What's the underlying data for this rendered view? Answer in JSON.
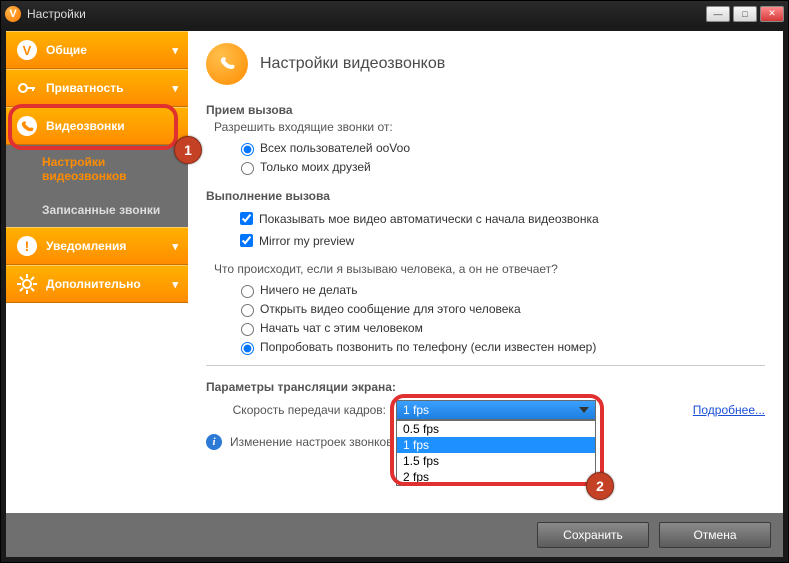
{
  "window": {
    "title": "Настройки"
  },
  "sidebar": {
    "general": "Общие",
    "privacy": "Приватность",
    "videocalls": "Видеозвонки",
    "sub_settings": "Настройки видеозвонков",
    "sub_recorded": "Записанные звонки",
    "notifications": "Уведомления",
    "additional": "Дополнительно"
  },
  "annotations": {
    "badge1": "1",
    "badge2": "2"
  },
  "page": {
    "title": "Настройки видеозвонков",
    "sec_incoming": "Прием вызова",
    "allow_incoming_from": "Разрешить входящие звонки от:",
    "radio_all_users": "Всех пользователей ooVoo",
    "radio_only_friends": "Только моих друзей",
    "sec_outgoing": "Выполнение вызова",
    "chk_show_video": "Показывать мое видео автоматически с начала видеозвонка",
    "chk_mirror": "Mirror my preview",
    "no_answer_q": "Что происходит, если я вызываю человека, а он не отвечает?",
    "radio_nothing": "Ничего не делать",
    "radio_openvideo": "Открыть видео сообщение для этого человека",
    "radio_startchat": "Начать чат с этим человеком",
    "radio_phonecall": "Попробовать позвонить по телефону (если известен номер)",
    "sec_screen": "Параметры трансляции экрана:",
    "fps_label": "Скорость передачи кадров:",
    "fps_selected": "1 fps",
    "fps_options": [
      "0.5 fps",
      "1 fps",
      "1.5 fps",
      "2 fps"
    ],
    "more_link": "Подробнее...",
    "note": "Изменение настроек звонков всту"
  },
  "footer": {
    "save": "Сохранить",
    "cancel": "Отмена"
  }
}
